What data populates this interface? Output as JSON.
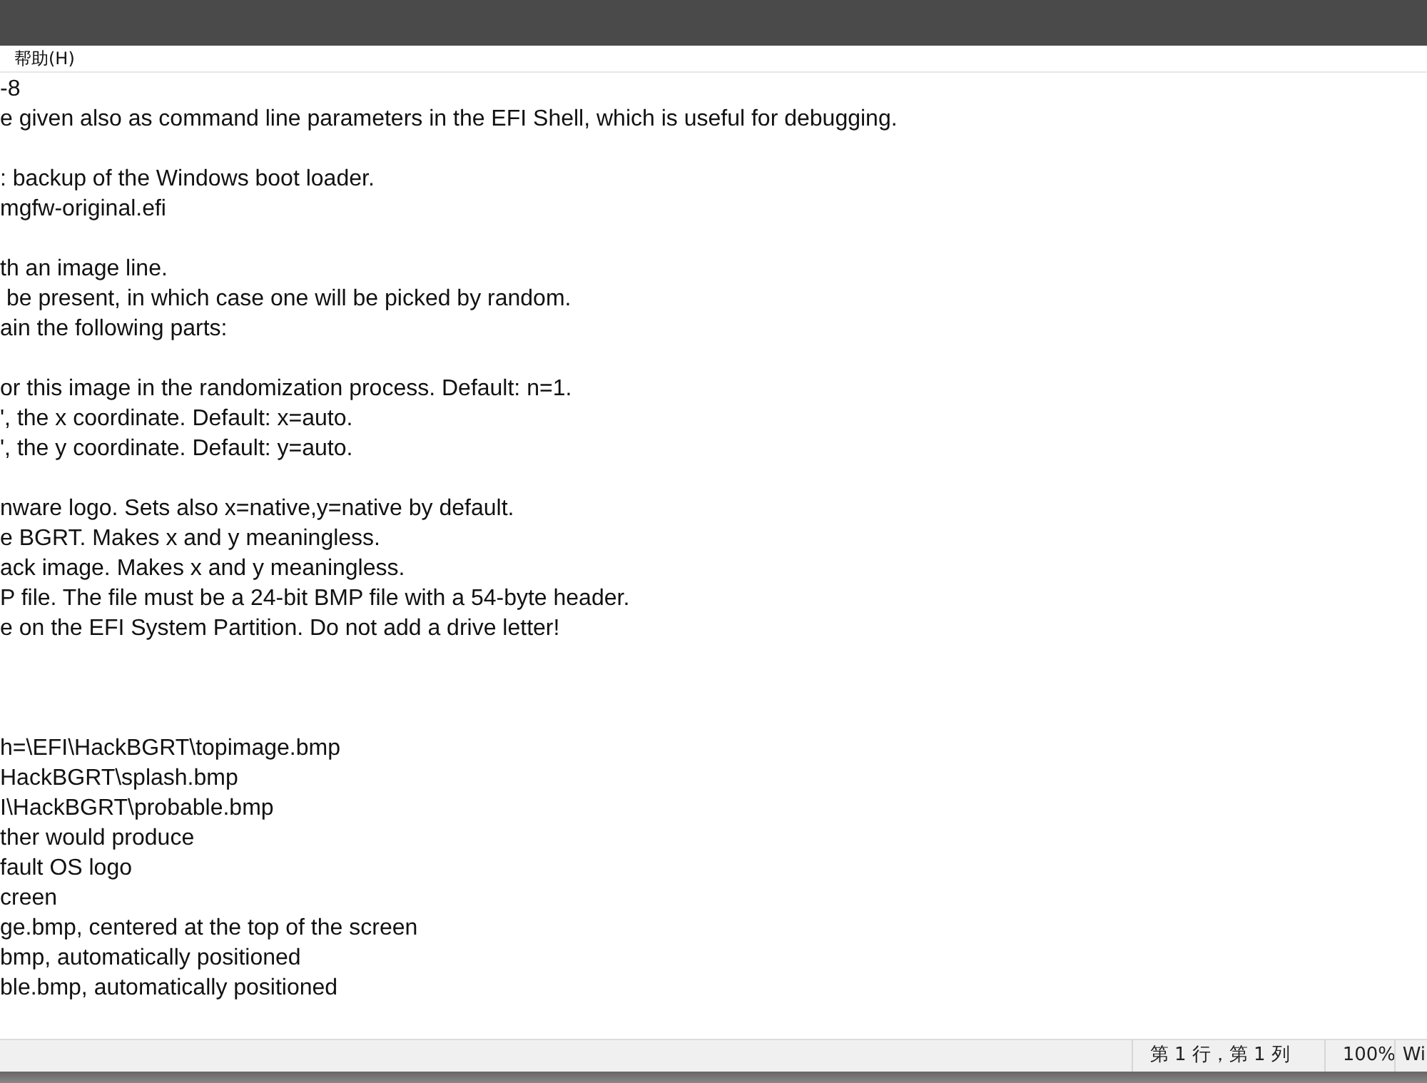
{
  "menu": {
    "items": [
      {
        "label": "帮助(H)"
      }
    ]
  },
  "editor": {
    "lines": [
      {
        "kind": "text",
        "text": "-8"
      },
      {
        "kind": "text",
        "text": "e given also as command line parameters in the EFI Shell, which is useful for debugging."
      },
      {
        "kind": "blank"
      },
      {
        "kind": "text",
        "text": ": backup of the Windows boot loader."
      },
      {
        "kind": "text",
        "text": "mgfw-original.efi"
      },
      {
        "kind": "blank"
      },
      {
        "kind": "text",
        "text": "th an image line."
      },
      {
        "kind": "text",
        "text": " be present, in which case one will be picked by random."
      },
      {
        "kind": "text",
        "text": "ain the following parts:"
      },
      {
        "kind": "blank"
      },
      {
        "kind": "text",
        "text": "or this image in the randomization process. Default: n=1."
      },
      {
        "kind": "text",
        "text": "', the x coordinate. Default: x=auto."
      },
      {
        "kind": "text",
        "text": "', the y coordinate. Default: y=auto."
      },
      {
        "kind": "blank"
      },
      {
        "kind": "text",
        "text": "nware logo. Sets also x=native,y=native by default."
      },
      {
        "kind": "text",
        "text": "e BGRT. Makes x and y meaningless."
      },
      {
        "kind": "text",
        "text": "ack image. Makes x and y meaningless."
      },
      {
        "kind": "text",
        "text": "P file. The file must be a 24-bit BMP file with a 54-byte header."
      },
      {
        "kind": "text",
        "text": "e on the EFI System Partition. Do not add a drive letter!"
      },
      {
        "kind": "blank"
      },
      {
        "kind": "blank"
      },
      {
        "kind": "blank"
      },
      {
        "kind": "text",
        "text": "h=\\EFI\\HackBGRT\\topimage.bmp"
      },
      {
        "kind": "text",
        "text": "HackBGRT\\splash.bmp"
      },
      {
        "kind": "text",
        "text": "I\\HackBGRT\\probable.bmp"
      },
      {
        "kind": "text",
        "text": "ther would produce"
      },
      {
        "kind": "text",
        "text": "fault OS logo"
      },
      {
        "kind": "text",
        "text": "creen"
      },
      {
        "kind": "text",
        "text": "ge.bmp, centered at the top of the screen"
      },
      {
        "kind": "text",
        "text": "bmp, automatically positioned"
      },
      {
        "kind": "text",
        "text": "ble.bmp, automatically positioned"
      }
    ]
  },
  "status_bar": {
    "position": "第 1 行，第 1 列",
    "zoom": "100%",
    "line_ending": "Wi"
  }
}
